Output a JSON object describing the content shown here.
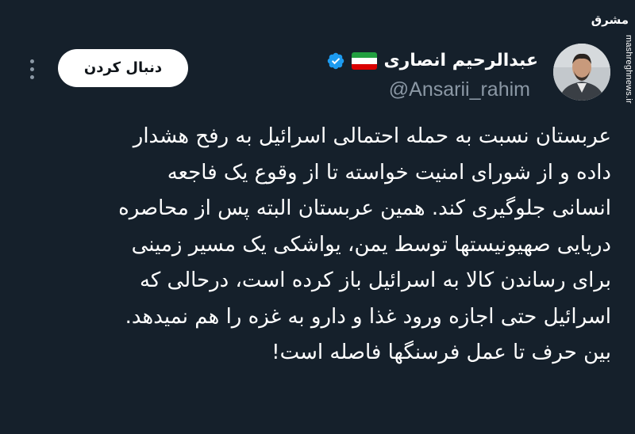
{
  "watermark": {
    "logo": "مشرق",
    "site": "mashreghnews.ir"
  },
  "author": {
    "display_name": "عبدالرحیم انصاری",
    "handle": "@Ansarii_rahim",
    "flag_colors": [
      "#239f40",
      "#ffffff",
      "#da0000"
    ],
    "verified_color": "#1d9bf0"
  },
  "actions": {
    "follow_label": "دنبال کردن"
  },
  "tweet": {
    "lines": [
      "عربستان نسبت به حمله احتمالی اسرائیل به رفح هشدار",
      "داده و از شورای امنیت خواسته تا از وقوع یک فاجعه",
      "انسانی جلوگیری کند. همین عربستان البته پس از محاصره",
      "دریایی صهیونیستها توسط یمن، یواشکی یک مسیر زمینی",
      "برای رساندن کالا به اسرائیل باز کرده است، درحالی که",
      "اسرائیل حتی اجازه ورود غذا و دارو به غزه را هم نمیدهد.",
      "بین حرف تا عمل فرسنگها فاصله است!"
    ]
  },
  "theme": {
    "background": "#15202b",
    "text": "#ffffff",
    "muted": "#8b98a5"
  }
}
